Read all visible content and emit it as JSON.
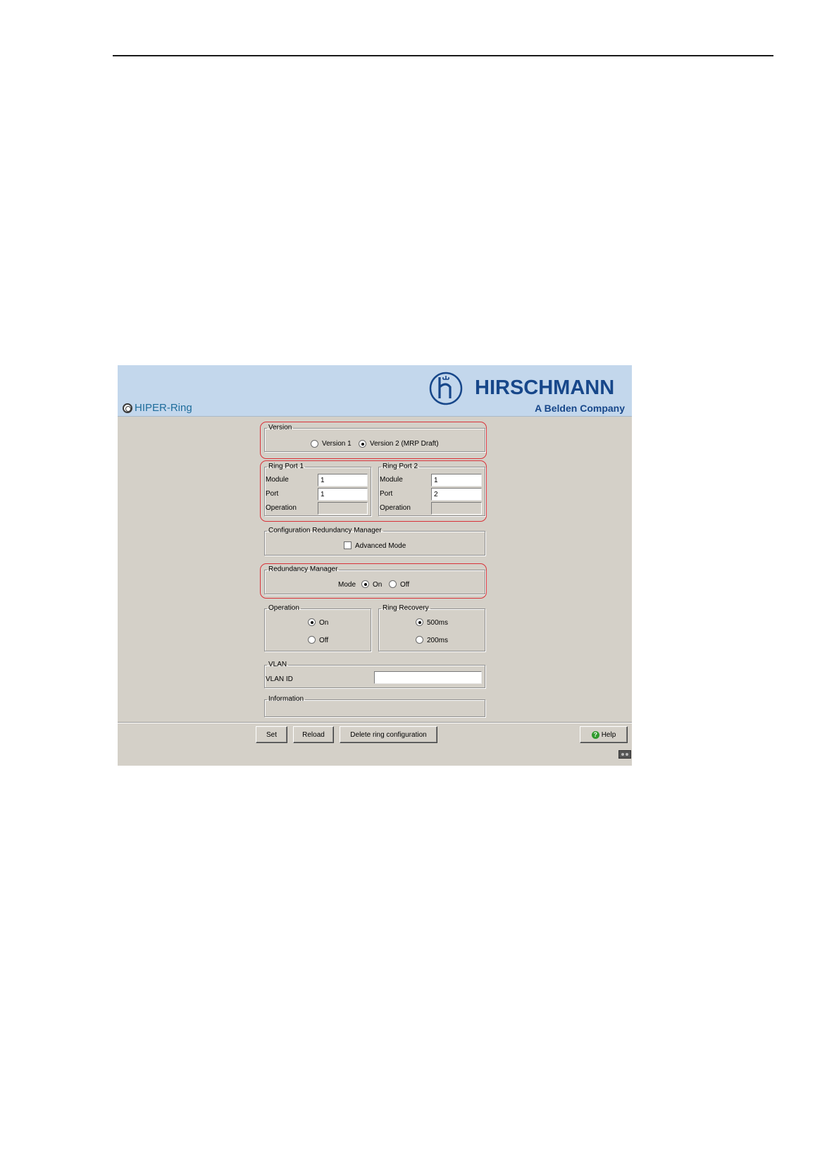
{
  "app": {
    "page_title": "HIPER-Ring",
    "brand_name": "HIRSCHMANN",
    "brand_tagline": "A Belden Company",
    "brand_color": "#17478a",
    "header_bg": "#c3d7ec",
    "highlight_color": "#d9333a"
  },
  "version": {
    "legend": "Version",
    "options": [
      {
        "label": "Version 1",
        "selected": false
      },
      {
        "label": "Version 2 (MRP Draft)",
        "selected": true
      }
    ]
  },
  "ring_port_1": {
    "legend": "Ring Port 1",
    "module_label": "Module",
    "module_value": "1",
    "port_label": "Port",
    "port_value": "1",
    "operation_label": "Operation",
    "operation_value": ""
  },
  "ring_port_2": {
    "legend": "Ring Port 2",
    "module_label": "Module",
    "module_value": "1",
    "port_label": "Port",
    "port_value": "2",
    "operation_label": "Operation",
    "operation_value": ""
  },
  "config_rm": {
    "legend": "Configuration Redundancy Manager",
    "advanced_mode_label": "Advanced Mode",
    "advanced_mode_checked": false
  },
  "redundancy_manager": {
    "legend": "Redundancy Manager",
    "mode_label": "Mode",
    "on_label": "On",
    "off_label": "Off",
    "selected": "On"
  },
  "operation": {
    "legend": "Operation",
    "on_label": "On",
    "off_label": "Off",
    "selected": "On"
  },
  "ring_recovery": {
    "legend": "Ring Recovery",
    "opt1_label": "500ms",
    "opt2_label": "200ms",
    "selected": "500ms"
  },
  "vlan": {
    "legend": "VLAN",
    "id_label": "VLAN ID",
    "id_value": ""
  },
  "information": {
    "legend": "Information"
  },
  "buttons": {
    "set": "Set",
    "reload": "Reload",
    "delete_ring": "Delete ring configuration",
    "help": "Help"
  },
  "icons": {
    "page_icon": "ring-icon",
    "help_icon": "help-icon",
    "corner_icon": "connection-status-icon"
  }
}
